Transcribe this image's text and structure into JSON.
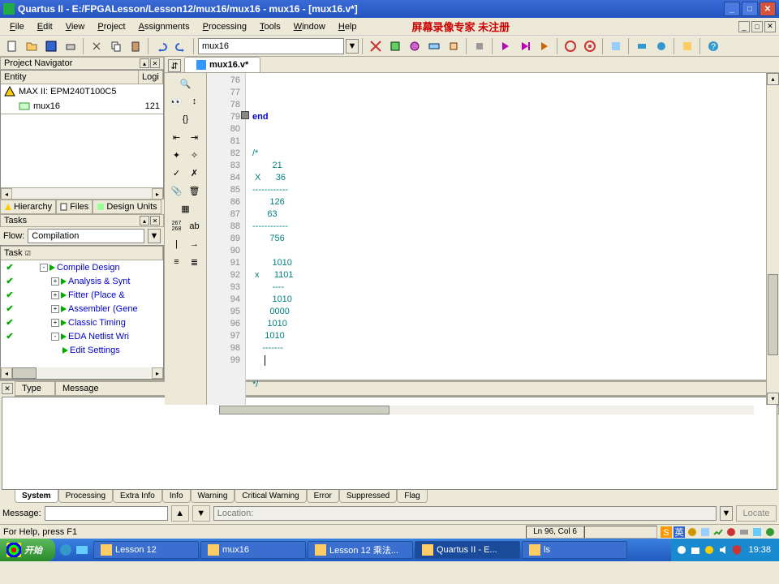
{
  "titlebar": {
    "text": "Quartus II - E:/FPGALesson/Lesson12/mux16/mux16 - mux16 - [mux16.v*]"
  },
  "menu": {
    "items": [
      "File",
      "Edit",
      "View",
      "Project",
      "Assignments",
      "Processing",
      "Tools",
      "Window",
      "Help"
    ],
    "banner": "屏幕录像专家 未注册"
  },
  "toolbar": {
    "combo": "mux16"
  },
  "project_navigator": {
    "title": "Project Navigator",
    "col_entity": "Entity",
    "col_logi": "Logi",
    "device": "MAX II: EPM240T100C5",
    "entity": "mux16",
    "logic": "121",
    "tabs": [
      "Hierarchy",
      "Files",
      "Design Units"
    ]
  },
  "tasks_panel": {
    "title": "Tasks",
    "flow_label": "Flow:",
    "flow_value": "Compilation",
    "col_task": "Task",
    "items": [
      {
        "check": true,
        "label": "Compile Design",
        "indent": 0,
        "expand": "-"
      },
      {
        "check": true,
        "label": "Analysis & Synt",
        "indent": 1,
        "expand": "+"
      },
      {
        "check": true,
        "label": "Fitter (Place &",
        "indent": 1,
        "expand": "+"
      },
      {
        "check": true,
        "label": "Assembler (Gene",
        "indent": 1,
        "expand": "+"
      },
      {
        "check": true,
        "label": "Classic Timing ",
        "indent": 1,
        "expand": "+"
      },
      {
        "check": true,
        "label": "EDA Netlist Wri",
        "indent": 1,
        "expand": "-"
      },
      {
        "check": false,
        "label": "Edit Settings",
        "indent": 2,
        "expand": ""
      }
    ]
  },
  "editor": {
    "tab": "mux16.v*",
    "gutter_start": 76,
    "lines": [
      "end",
      "",
      "",
      "/*",
      "        21",
      " X      36",
      "------------",
      "       126",
      "      63",
      "------------",
      "       756",
      "",
      "        1010",
      " x      1101",
      "        ----",
      "        1010",
      "       0000",
      "      1010",
      "     1010",
      "    -------",
      "",
      "",
      "*/",
      ""
    ]
  },
  "messages": {
    "cols": [
      "Type",
      "Message"
    ],
    "tabs": [
      "System",
      "Processing",
      "Extra Info",
      "Info",
      "Warning",
      "Critical Warning",
      "Error",
      "Suppressed",
      "Flag"
    ],
    "msg_label": "Message:",
    "loc_placeholder": "Location:",
    "locate_btn": "Locate"
  },
  "statusbar": {
    "help": "For Help, press F1",
    "pos": "Ln 96, Col 6"
  },
  "taskbar": {
    "start": "开始",
    "tasks": [
      {
        "label": "Lesson 12",
        "active": false
      },
      {
        "label": "mux16",
        "active": false
      },
      {
        "label": "Lesson 12 乘法...",
        "active": false
      },
      {
        "label": "Quartus II - E...",
        "active": true
      },
      {
        "label": "ls",
        "active": false
      }
    ],
    "clock": "19:38",
    "lang": "英"
  }
}
